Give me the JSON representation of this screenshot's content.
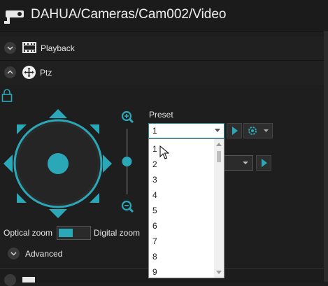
{
  "header": {
    "title": "DAHUA/Cameras/Cam002/Video",
    "icon": "security-camera-icon"
  },
  "sections": {
    "playback": {
      "label": "Playback",
      "icon": "film-strip-icon",
      "state": "collapsed"
    },
    "ptz": {
      "label": "Ptz",
      "icon": "move-arrows-icon",
      "state": "expanded"
    },
    "advanced": {
      "label": "Advanced",
      "state": "collapsed"
    }
  },
  "ptz": {
    "preset_label": "Preset",
    "preset_selected": "1",
    "preset_options": [
      "1",
      "2",
      "3",
      "4",
      "5",
      "6",
      "7",
      "8",
      "9"
    ],
    "zoom_level": 0.5,
    "optical_zoom_label": "Optical zoom",
    "digital_zoom_label": "Digital zoom",
    "lock_icon": "lock-icon"
  },
  "colors": {
    "accent": "#2aa8b8",
    "background": "#1e1e1e",
    "header": "#1b1b1b"
  }
}
